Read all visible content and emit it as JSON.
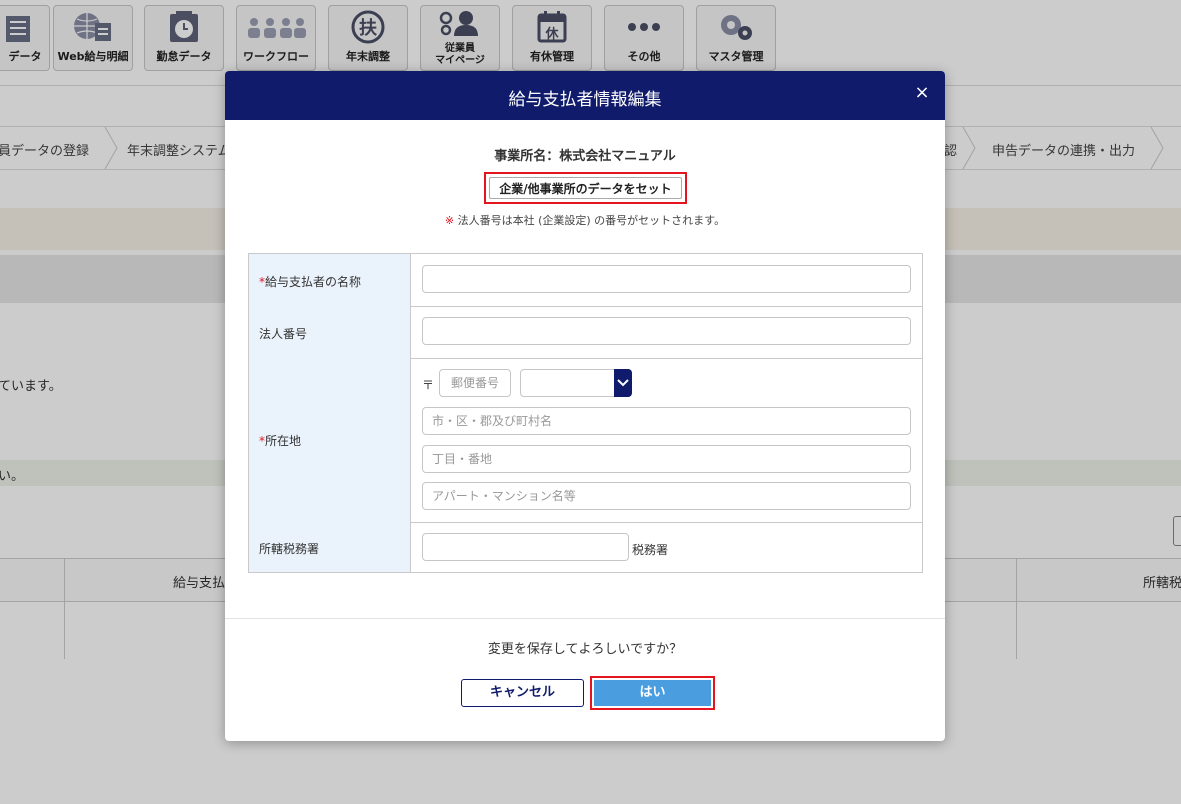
{
  "toolbar": {
    "items": [
      {
        "label": "データ",
        "icon": "data-icon"
      },
      {
        "label": "Web給与明細",
        "icon": "web-payslip-icon"
      },
      {
        "label": "勤怠データ",
        "icon": "attendance-icon"
      },
      {
        "label": "ワークフロー",
        "icon": "workflow-icon"
      },
      {
        "label": "年末調整",
        "icon": "year-end-adjustment-icon"
      },
      {
        "label": "従業員",
        "label2": "マイページ",
        "icon": "employee-mypage-icon"
      },
      {
        "label": "有休管理",
        "icon": "paid-leave-icon"
      },
      {
        "label": "その他",
        "icon": "more-icon"
      },
      {
        "label": "マスタ管理",
        "icon": "master-settings-icon"
      }
    ]
  },
  "steps": {
    "items": [
      "員データの登録",
      "年末調整システム",
      "認",
      "申告データの連携・出力"
    ]
  },
  "background": {
    "text_mid": "ています。",
    "text_band": "い。",
    "table_col1": "給与支払",
    "table_col2": "所轄税"
  },
  "modal": {
    "title": "給与支払者情報編集",
    "close_label": "×",
    "office_name": "事業所名：株式会社マニュアル",
    "set_button": "企業/他事業所のデータをセット",
    "note_mark": "※",
    "note_text": "法人番号は本社 (企業設定) の番号がセットされます。",
    "fields": {
      "payer_name": {
        "label": "給与支払者の名称",
        "required_mark": "*",
        "value": ""
      },
      "corp_number": {
        "label": "法人番号",
        "value": ""
      },
      "address": {
        "label": "所在地",
        "required_mark": "*",
        "postal_mark": "〒",
        "postal_placeholder": "郵便番号",
        "prefecture_value": "",
        "city_placeholder": "市・区・郡及び町村名",
        "street_placeholder": "丁目・番地",
        "building_placeholder": "アパート・マンション名等"
      },
      "tax_office": {
        "label": "所轄税務署",
        "value": "",
        "suffix": "税務署"
      }
    },
    "confirm_text": "変更を保存してよろしいですか？",
    "cancel_label": "キャンセル",
    "ok_label": "はい"
  },
  "colors": {
    "header": "#101c6b",
    "highlight": "#e5141e",
    "ok": "#4a9ee0",
    "label_bg": "#eaf2fb"
  }
}
